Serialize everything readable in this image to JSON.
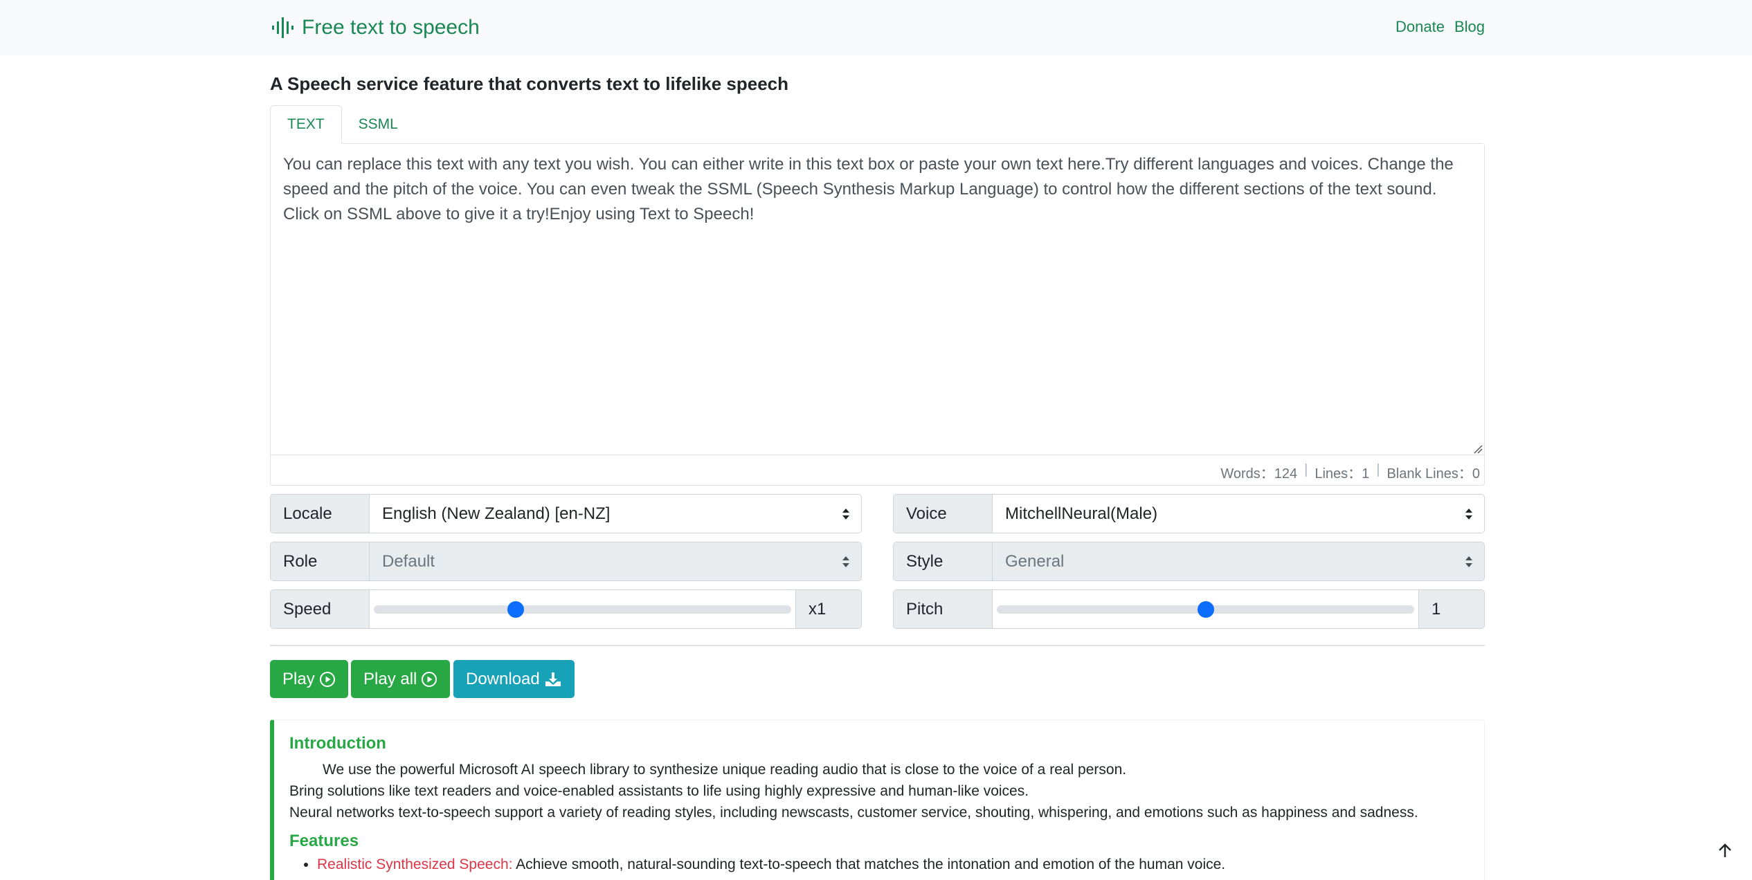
{
  "header": {
    "brand": "Free text to speech",
    "links": [
      "Donate",
      "Blog"
    ]
  },
  "headline": "A Speech service feature that converts text to lifelike speech",
  "tabs": [
    {
      "label": "TEXT",
      "active": true
    },
    {
      "label": "SSML",
      "active": false
    }
  ],
  "editor": {
    "text": "You can replace this text with any text you wish. You can either write in this text box or paste your own text here.Try different languages and voices. Change the speed and the pitch of the voice. You can even tweak the SSML (Speech Synthesis Markup Language) to control how the different sections of the text sound. Click on SSML above to give it a try!Enjoy using Text to Speech!",
    "words_label": "Words：124",
    "lines_label": "Lines：1",
    "blank_lines_label": "Blank Lines：0",
    "separator": "|"
  },
  "controls": {
    "locale": {
      "label": "Locale",
      "value": "English (New Zealand) [en-NZ]"
    },
    "voice": {
      "label": "Voice",
      "value": "MitchellNeural(Male)"
    },
    "role": {
      "label": "Role",
      "value": "Default"
    },
    "style": {
      "label": "Style",
      "value": "General"
    },
    "speed": {
      "label": "Speed",
      "value_text": "x1",
      "slider_fraction": 0.34
    },
    "pitch": {
      "label": "Pitch",
      "value_text": "1",
      "slider_fraction": 0.5
    }
  },
  "buttons": {
    "play": "Play",
    "play_all": "Play all",
    "download": "Download"
  },
  "intro": {
    "title": "Introduction",
    "lines": [
      "We use the powerful Microsoft AI speech library to synthesize unique reading audio that is close to the voice of a real person.",
      "Bring solutions like text readers and voice-enabled assistants to life using highly expressive and human-like voices.",
      "Neural networks text-to-speech support a variety of reading styles, including newscasts, customer service, shouting, whispering, and emotions such as happiness and sadness."
    ],
    "features_title": "Features",
    "features": [
      {
        "highlight": "Realistic Synthesized Speech:",
        "text": " Achieve smooth, natural-sounding text-to-speech that matches the intonation and emotion of the human voice."
      }
    ]
  },
  "colors": {
    "accent_green": "#198754",
    "button_green": "#28a745",
    "button_teal": "#17a2b8",
    "slider_blue": "#0d6efd"
  }
}
